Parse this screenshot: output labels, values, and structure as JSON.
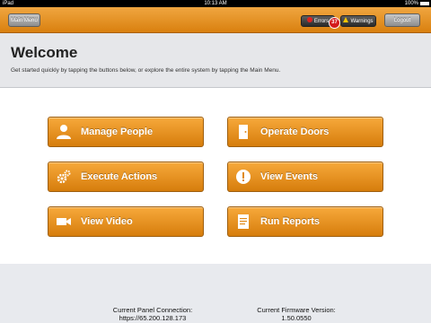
{
  "status_bar": {
    "device": "iPad",
    "time": "10:13 AM",
    "battery": "100%"
  },
  "nav": {
    "main_menu": "Main Menu",
    "errors_label": "Errors",
    "errors_count": "37",
    "warnings_label": "Warnings",
    "logout": "Logout"
  },
  "welcome": {
    "title": "Welcome",
    "subtitle": "Get started quickly by tapping the buttons below, or explore the entire system by tapping the Main Menu."
  },
  "actions": [
    {
      "label": "Manage People",
      "icon": "person-icon"
    },
    {
      "label": "Operate Doors",
      "icon": "door-icon"
    },
    {
      "label": "Execute Actions",
      "icon": "gears-icon"
    },
    {
      "label": "View Events",
      "icon": "alert-icon"
    },
    {
      "label": "View Video",
      "icon": "video-camera-icon"
    },
    {
      "label": "Run Reports",
      "icon": "report-icon"
    }
  ],
  "footer": {
    "connection_label": "Current Panel Connection:",
    "connection_value": "https://65.200.128.173",
    "firmware_label": "Current Firmware Version:",
    "firmware_value": "1.50.0550"
  },
  "colors": {
    "accent": "#e8901f",
    "error": "#d41c1c",
    "warning": "#f7c600"
  }
}
